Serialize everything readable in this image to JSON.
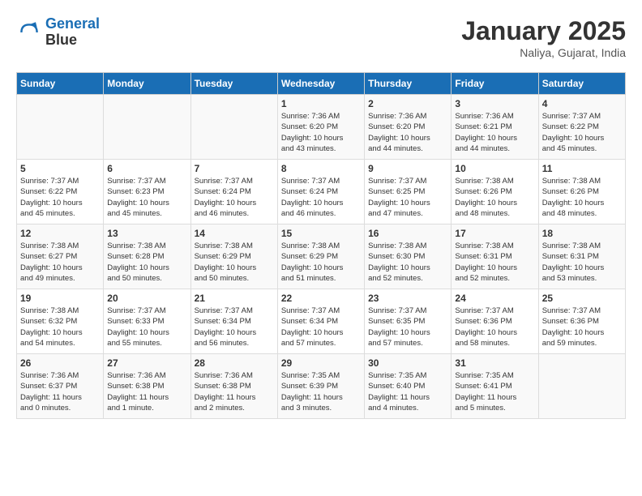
{
  "header": {
    "logo_line1": "General",
    "logo_line2": "Blue",
    "title": "January 2025",
    "subtitle": "Naliya, Gujarat, India"
  },
  "days_of_week": [
    "Sunday",
    "Monday",
    "Tuesday",
    "Wednesday",
    "Thursday",
    "Friday",
    "Saturday"
  ],
  "weeks": [
    [
      {
        "day": "",
        "info": ""
      },
      {
        "day": "",
        "info": ""
      },
      {
        "day": "",
        "info": ""
      },
      {
        "day": "1",
        "info": "Sunrise: 7:36 AM\nSunset: 6:20 PM\nDaylight: 10 hours\nand 43 minutes."
      },
      {
        "day": "2",
        "info": "Sunrise: 7:36 AM\nSunset: 6:20 PM\nDaylight: 10 hours\nand 44 minutes."
      },
      {
        "day": "3",
        "info": "Sunrise: 7:36 AM\nSunset: 6:21 PM\nDaylight: 10 hours\nand 44 minutes."
      },
      {
        "day": "4",
        "info": "Sunrise: 7:37 AM\nSunset: 6:22 PM\nDaylight: 10 hours\nand 45 minutes."
      }
    ],
    [
      {
        "day": "5",
        "info": "Sunrise: 7:37 AM\nSunset: 6:22 PM\nDaylight: 10 hours\nand 45 minutes."
      },
      {
        "day": "6",
        "info": "Sunrise: 7:37 AM\nSunset: 6:23 PM\nDaylight: 10 hours\nand 45 minutes."
      },
      {
        "day": "7",
        "info": "Sunrise: 7:37 AM\nSunset: 6:24 PM\nDaylight: 10 hours\nand 46 minutes."
      },
      {
        "day": "8",
        "info": "Sunrise: 7:37 AM\nSunset: 6:24 PM\nDaylight: 10 hours\nand 46 minutes."
      },
      {
        "day": "9",
        "info": "Sunrise: 7:37 AM\nSunset: 6:25 PM\nDaylight: 10 hours\nand 47 minutes."
      },
      {
        "day": "10",
        "info": "Sunrise: 7:38 AM\nSunset: 6:26 PM\nDaylight: 10 hours\nand 48 minutes."
      },
      {
        "day": "11",
        "info": "Sunrise: 7:38 AM\nSunset: 6:26 PM\nDaylight: 10 hours\nand 48 minutes."
      }
    ],
    [
      {
        "day": "12",
        "info": "Sunrise: 7:38 AM\nSunset: 6:27 PM\nDaylight: 10 hours\nand 49 minutes."
      },
      {
        "day": "13",
        "info": "Sunrise: 7:38 AM\nSunset: 6:28 PM\nDaylight: 10 hours\nand 50 minutes."
      },
      {
        "day": "14",
        "info": "Sunrise: 7:38 AM\nSunset: 6:29 PM\nDaylight: 10 hours\nand 50 minutes."
      },
      {
        "day": "15",
        "info": "Sunrise: 7:38 AM\nSunset: 6:29 PM\nDaylight: 10 hours\nand 51 minutes."
      },
      {
        "day": "16",
        "info": "Sunrise: 7:38 AM\nSunset: 6:30 PM\nDaylight: 10 hours\nand 52 minutes."
      },
      {
        "day": "17",
        "info": "Sunrise: 7:38 AM\nSunset: 6:31 PM\nDaylight: 10 hours\nand 52 minutes."
      },
      {
        "day": "18",
        "info": "Sunrise: 7:38 AM\nSunset: 6:31 PM\nDaylight: 10 hours\nand 53 minutes."
      }
    ],
    [
      {
        "day": "19",
        "info": "Sunrise: 7:38 AM\nSunset: 6:32 PM\nDaylight: 10 hours\nand 54 minutes."
      },
      {
        "day": "20",
        "info": "Sunrise: 7:37 AM\nSunset: 6:33 PM\nDaylight: 10 hours\nand 55 minutes."
      },
      {
        "day": "21",
        "info": "Sunrise: 7:37 AM\nSunset: 6:34 PM\nDaylight: 10 hours\nand 56 minutes."
      },
      {
        "day": "22",
        "info": "Sunrise: 7:37 AM\nSunset: 6:34 PM\nDaylight: 10 hours\nand 57 minutes."
      },
      {
        "day": "23",
        "info": "Sunrise: 7:37 AM\nSunset: 6:35 PM\nDaylight: 10 hours\nand 57 minutes."
      },
      {
        "day": "24",
        "info": "Sunrise: 7:37 AM\nSunset: 6:36 PM\nDaylight: 10 hours\nand 58 minutes."
      },
      {
        "day": "25",
        "info": "Sunrise: 7:37 AM\nSunset: 6:36 PM\nDaylight: 10 hours\nand 59 minutes."
      }
    ],
    [
      {
        "day": "26",
        "info": "Sunrise: 7:36 AM\nSunset: 6:37 PM\nDaylight: 11 hours\nand 0 minutes."
      },
      {
        "day": "27",
        "info": "Sunrise: 7:36 AM\nSunset: 6:38 PM\nDaylight: 11 hours\nand 1 minute."
      },
      {
        "day": "28",
        "info": "Sunrise: 7:36 AM\nSunset: 6:38 PM\nDaylight: 11 hours\nand 2 minutes."
      },
      {
        "day": "29",
        "info": "Sunrise: 7:35 AM\nSunset: 6:39 PM\nDaylight: 11 hours\nand 3 minutes."
      },
      {
        "day": "30",
        "info": "Sunrise: 7:35 AM\nSunset: 6:40 PM\nDaylight: 11 hours\nand 4 minutes."
      },
      {
        "day": "31",
        "info": "Sunrise: 7:35 AM\nSunset: 6:41 PM\nDaylight: 11 hours\nand 5 minutes."
      },
      {
        "day": "",
        "info": ""
      }
    ]
  ]
}
